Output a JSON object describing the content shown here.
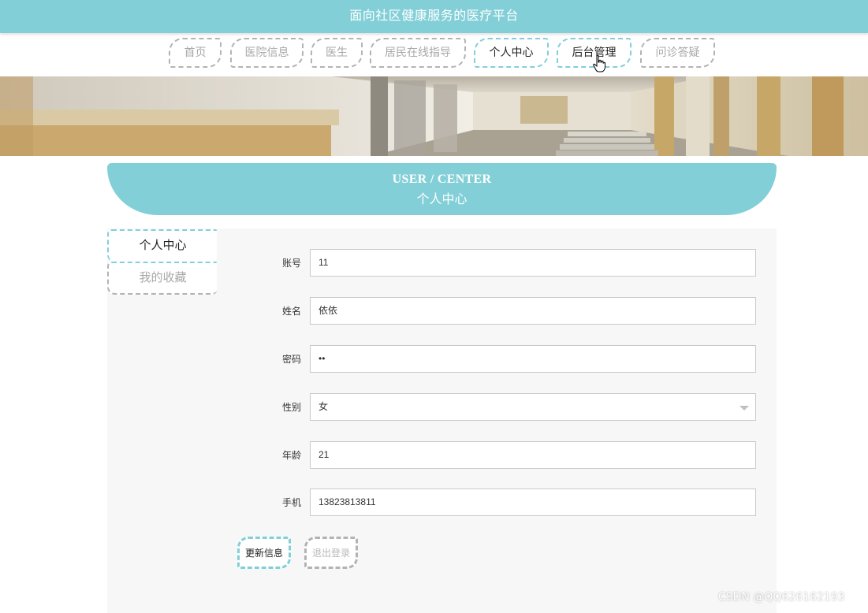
{
  "site": {
    "title": "面向社区健康服务的医疗平台"
  },
  "nav": {
    "items": [
      {
        "label": "首页"
      },
      {
        "label": "医院信息"
      },
      {
        "label": "医生"
      },
      {
        "label": "居民在线指导"
      },
      {
        "label": "个人中心"
      },
      {
        "label": "后台管理"
      },
      {
        "label": "问诊答疑"
      }
    ],
    "active_item": "个人中心"
  },
  "section": {
    "title_en": "USER / CENTER",
    "title_cn": "个人中心"
  },
  "sidebar": {
    "items": [
      {
        "label": "个人中心",
        "active": true
      },
      {
        "label": "我的收藏",
        "active": false
      }
    ]
  },
  "form": {
    "fields": [
      {
        "label": "账号",
        "value": "11"
      },
      {
        "label": "姓名",
        "value": "依依"
      },
      {
        "label": "密码",
        "value": "••"
      },
      {
        "label": "性别",
        "value": "女",
        "type": "select"
      },
      {
        "label": "年龄",
        "value": "21"
      },
      {
        "label": "手机",
        "value": "13823813811"
      }
    ]
  },
  "actions": {
    "update_label": "更新信息",
    "logout_label": "退出登录"
  },
  "watermark": {
    "text": "CSDN @QQ626162193"
  },
  "colors": {
    "accent": "#82cfd7",
    "inactive_text": "#a8a8a8",
    "inactive_border": "#b3b3b3",
    "content_bg": "#f7f7f7"
  },
  "icons": {
    "select_caret": "chevron-down-icon",
    "cursor": "hand-pointer-icon"
  }
}
